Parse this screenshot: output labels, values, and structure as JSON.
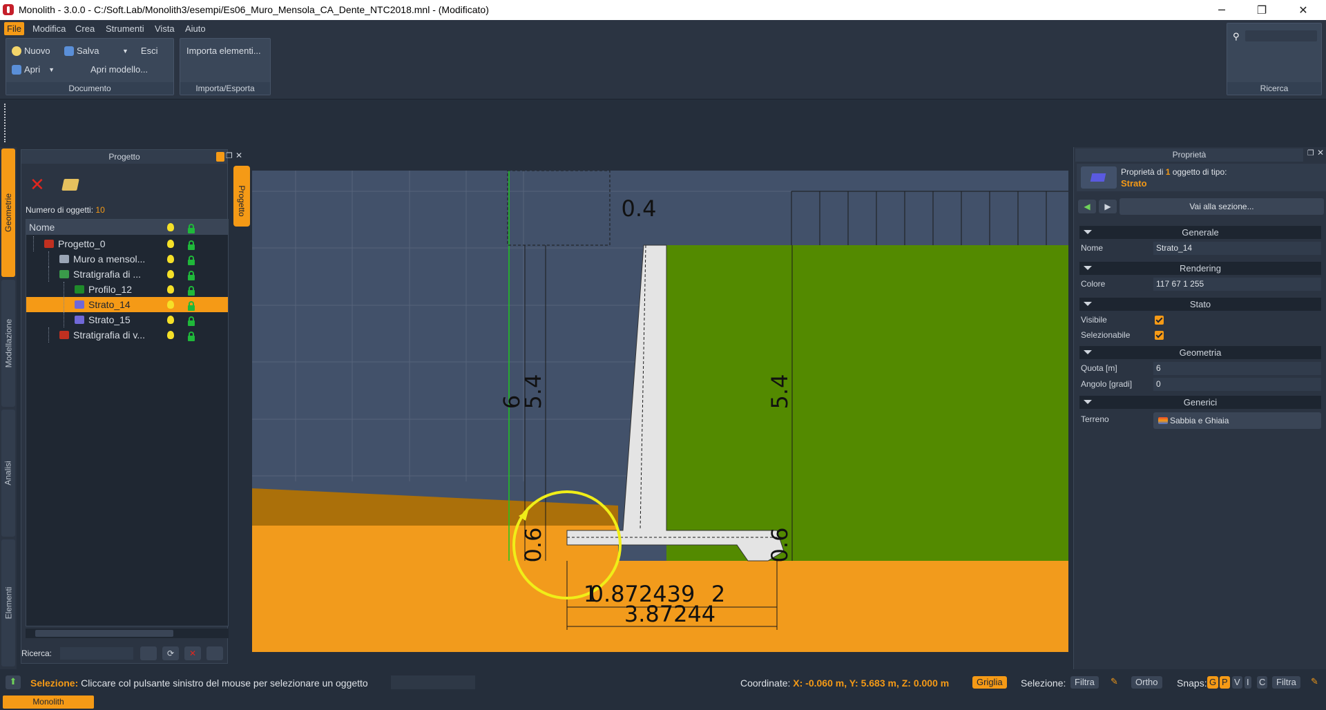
{
  "window": {
    "title": "Monolith - 3.0.0 - C:/Soft.Lab/Monolith3/esempi/Es06_Muro_Mensola_CA_Dente_NTC2018.mnl - (Modificato)",
    "minimize": "─",
    "maximize": "❐",
    "close": "✕"
  },
  "menu": {
    "items": [
      "File",
      "Modifica",
      "Crea",
      "Strumenti",
      "Vista",
      "Aiuto"
    ]
  },
  "ribbon": {
    "documento": {
      "title": "Documento",
      "nuovo": "Nuovo",
      "salva": "Salva",
      "esci": "Esci",
      "apri": "Apri",
      "apri_modello": "Apri modello..."
    },
    "importa": {
      "title": "Importa/Esporta",
      "importa_elementi": "Importa elementi..."
    },
    "ricerca": {
      "title": "Ricerca",
      "placeholder": ""
    }
  },
  "left_tabs": [
    "Geometrie",
    "Modellazione",
    "Analisi",
    "Elementi"
  ],
  "project_panel": {
    "title": "Progetto",
    "count_label": "Numero di oggetti:",
    "count_value": "10",
    "column_name": "Nome",
    "rows": [
      {
        "label": "Progetto_0",
        "indent": 0,
        "icon_color": "#c03020"
      },
      {
        "label": "Muro a mensol...",
        "indent": 1,
        "icon_color": "#9aa5b5"
      },
      {
        "label": "Stratigrafia di ...",
        "indent": 1,
        "icon_color": "#3a9a4a"
      },
      {
        "label": "Profilo_12",
        "indent": 2,
        "icon_color": "#1f8a2a"
      },
      {
        "label": "Strato_14",
        "indent": 2,
        "icon_color": "#7068d8",
        "selected": true
      },
      {
        "label": "Strato_15",
        "indent": 2,
        "icon_color": "#7068d8"
      },
      {
        "label": "Stratigrafia di v...",
        "indent": 1,
        "icon_color": "#c03020"
      }
    ],
    "search_label": "Ricerca:",
    "search_value": ""
  },
  "side_tab": "Progetto",
  "drawing": {
    "labels": {
      "top_width": "0.4",
      "height_total": "6",
      "height_stem_left": "5.4",
      "height_stem_right": "5.4",
      "base_left": "0.6",
      "base_right": "0.6",
      "dim_a": "1",
      "dim_b": "0.872439",
      "dim_c": "2",
      "dim_total": "3.87244"
    },
    "colors": {
      "background": "#42516a",
      "backfill": "#538a00",
      "foundation_soil": "#f29b1c",
      "front_soil": "#ab700a",
      "wall": "#e4e4e4",
      "axis": "#1ec81e",
      "rotate_gizmo": "#f0ee18"
    }
  },
  "properties": {
    "title": "Proprietà",
    "summary_prefix": "Proprietà di",
    "summary_count": "1",
    "summary_suffix": "oggetto di tipo:",
    "type": "Strato",
    "goto": "Vai alla sezione...",
    "sections": {
      "generale": "Generale",
      "rendering": "Rendering",
      "stato": "Stato",
      "geometria": "Geometria",
      "generici": "Generici"
    },
    "fields": {
      "nome_label": "Nome",
      "nome_value": "Strato_14",
      "colore_label": "Colore",
      "colore_value": "117 67 1 255",
      "visibile_label": "Visibile",
      "visibile": true,
      "selezionabile_label": "Selezionabile",
      "selezionabile": true,
      "quota_label": "Quota [m]",
      "quota_value": "6",
      "angolo_label": "Angolo [gradi]",
      "angolo_value": "0",
      "terreno_label": "Terreno",
      "terreno_value": "Sabbia e Ghiaia"
    }
  },
  "status": {
    "mode": "Selezione:",
    "message": "Cliccare col pulsante sinistro del mouse per selezionare un oggetto",
    "coord_label": "Coordinate:",
    "coord_value": "X: -0.060 m, Y: 5.683 m, Z: 0.000 m",
    "griglia": "Griglia",
    "selezione_label": "Selezione:",
    "filtra": "Filtra",
    "ortho": "Ortho",
    "snaps_label": "Snaps:",
    "snaps": [
      "G",
      "P",
      "V",
      "I",
      "C"
    ],
    "filtra2": "Filtra"
  },
  "taskbar": {
    "tab": "Monolith"
  }
}
